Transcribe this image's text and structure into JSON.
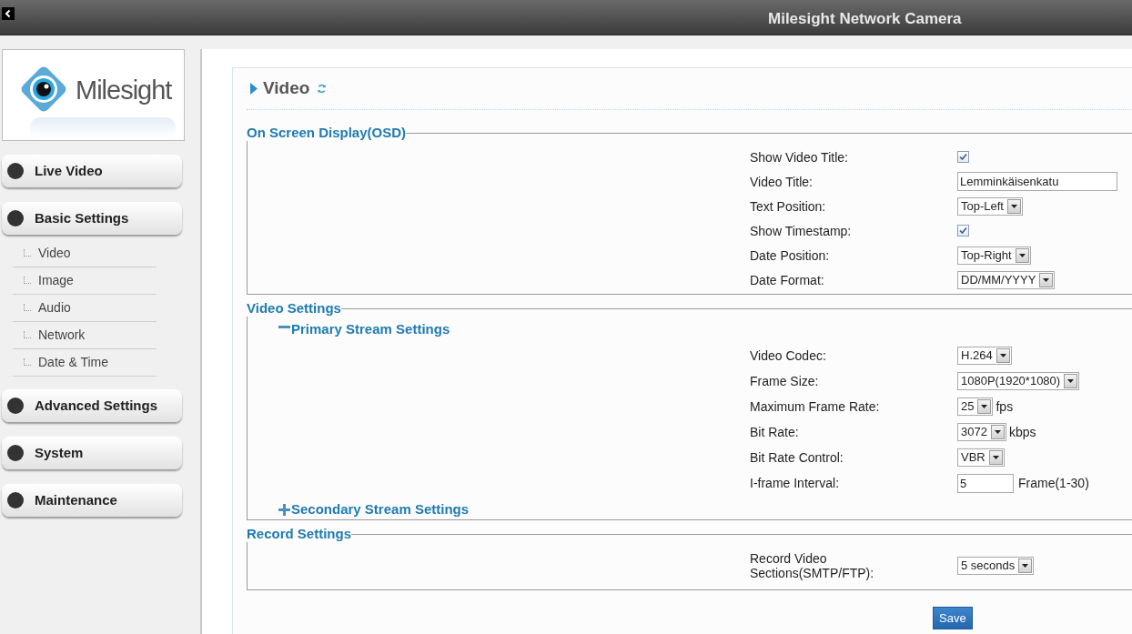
{
  "header": {
    "title": "Milesight Network Camera"
  },
  "logo": {
    "text": "Milesight"
  },
  "sidebar": {
    "menu": [
      {
        "label": "Live Video"
      },
      {
        "label": "Basic Settings",
        "children": [
          {
            "label": "Video"
          },
          {
            "label": "Image"
          },
          {
            "label": "Audio"
          },
          {
            "label": "Network"
          },
          {
            "label": "Date & Time"
          }
        ]
      },
      {
        "label": "Advanced Settings"
      },
      {
        "label": "System"
      },
      {
        "label": "Maintenance"
      }
    ]
  },
  "page": {
    "title": "Video"
  },
  "sections": [
    {
      "title": "On Screen Display(OSD)",
      "fields": [
        {
          "kind": "checkbox",
          "label": "Show Video Title:",
          "checked": true
        },
        {
          "kind": "text",
          "label": "Video Title:",
          "value": "Lemminkäisenkatu"
        },
        {
          "kind": "select",
          "label": "Text Position:",
          "value": "Top-Left"
        },
        {
          "kind": "checkbox",
          "label": "Show Timestamp:",
          "checked": true
        },
        {
          "kind": "select",
          "label": "Date Position:",
          "value": "Top-Right"
        },
        {
          "kind": "select",
          "label": "Date Format:",
          "value": "DD/MM/YYYY"
        }
      ]
    },
    {
      "title": "Video Settings",
      "groups": [
        {
          "title": "Primary Stream Settings",
          "expanded": true,
          "fields": [
            {
              "kind": "select",
              "label": "Video Codec:",
              "value": "H.264"
            },
            {
              "kind": "select",
              "label": "Frame Size:",
              "value": "1080P(1920*1080)"
            },
            {
              "kind": "select",
              "label": "Maximum Frame Rate:",
              "value": "25",
              "unit": "fps"
            },
            {
              "kind": "select",
              "label": "Bit Rate:",
              "value": "3072",
              "unit": "kbps"
            },
            {
              "kind": "select",
              "label": "Bit Rate Control:",
              "value": "VBR"
            },
            {
              "kind": "text",
              "label": "I-frame Interval:",
              "value": "5",
              "unit": "Frame(1-30)"
            }
          ]
        },
        {
          "title": "Secondary Stream Settings",
          "expanded": false
        }
      ]
    },
    {
      "title": "Record Settings",
      "fields": [
        {
          "kind": "select",
          "label": "Record Video Sections(SMTP/FTP):",
          "value": "5 seconds"
        }
      ]
    }
  ],
  "save_button": "Save"
}
